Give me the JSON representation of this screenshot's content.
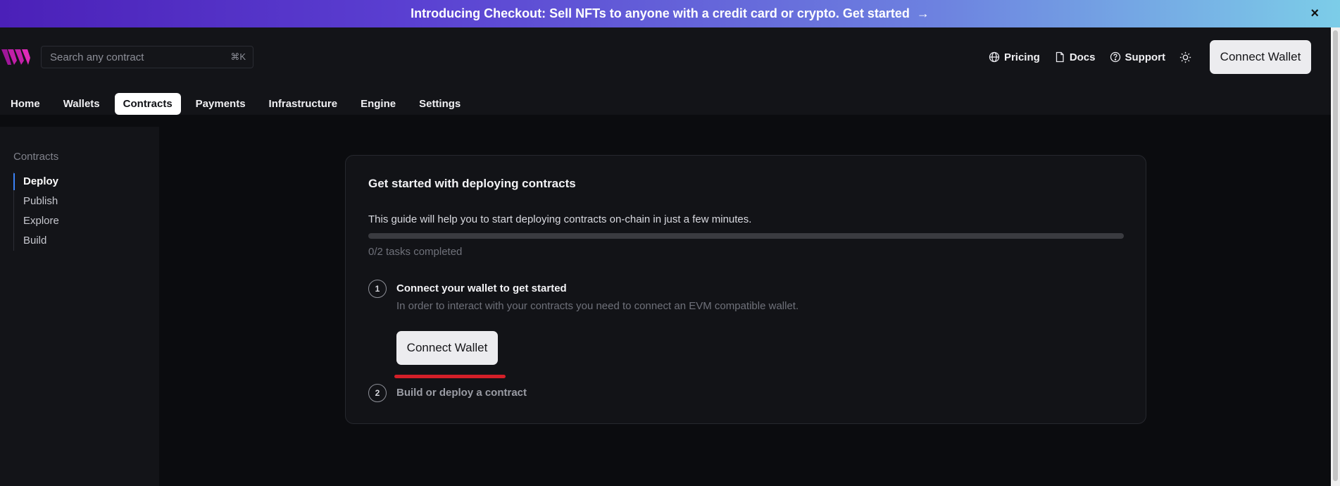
{
  "banner": {
    "text": "Introducing Checkout: Sell NFTs to anyone with a credit card or crypto. Get started",
    "arrow": "→",
    "close": "×"
  },
  "header": {
    "search_placeholder": "Search any contract",
    "search_shortcut": "⌘K",
    "links": {
      "pricing": "Pricing",
      "docs": "Docs",
      "support": "Support"
    },
    "connect_wallet": "Connect Wallet"
  },
  "mainnav": {
    "items": [
      "Home",
      "Wallets",
      "Contracts",
      "Payments",
      "Infrastructure",
      "Engine",
      "Settings"
    ],
    "active": "Contracts"
  },
  "sidebar": {
    "heading": "Contracts",
    "items": [
      "Deploy",
      "Publish",
      "Explore",
      "Build"
    ],
    "active": "Deploy"
  },
  "card": {
    "title": "Get started with deploying contracts",
    "description": "This guide will help you to start deploying contracts on-chain in just a few minutes.",
    "progress_fraction": 0,
    "tasks_text": "0/2 tasks completed",
    "steps": [
      {
        "number": "1",
        "title": "Connect your wallet to get started",
        "description": "In order to interact with your contracts you need to connect an EVM compatible wallet.",
        "button": "Connect Wallet"
      },
      {
        "number": "2",
        "title": "Build or deploy a contract"
      }
    ]
  },
  "colors": {
    "banner_start": "#4b20b8",
    "banner_end": "#7ccde8",
    "active_indicator": "#3b82f6",
    "annotation_underline": "#d41f28",
    "logo": "#c21fa8"
  }
}
